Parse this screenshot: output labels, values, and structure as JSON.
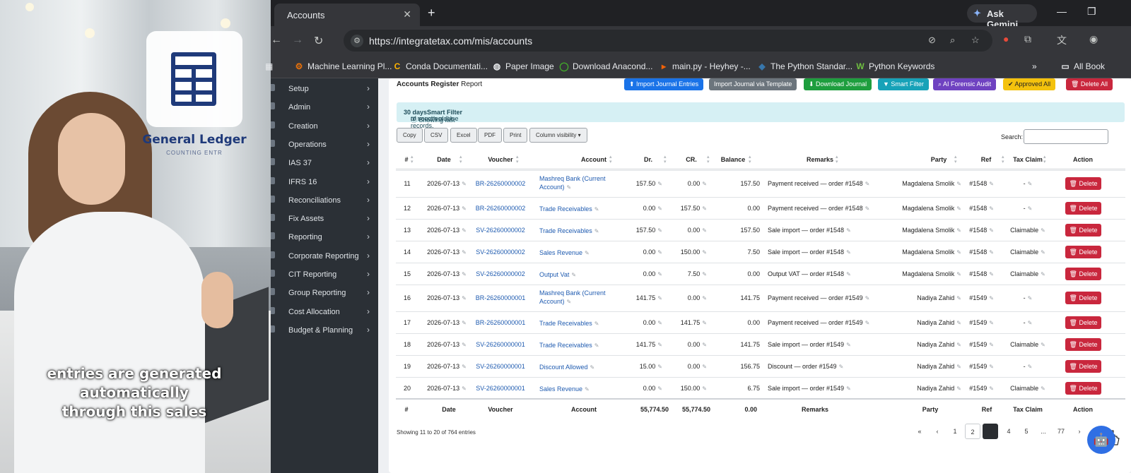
{
  "video": {
    "logo_title": "General Ledger",
    "logo_subtitle": "COUNTING ENTR",
    "caption": [
      "entries are generated",
      "automatically",
      "through this sales"
    ]
  },
  "browser": {
    "tab_title": "Accounts",
    "ask_gemini": "Ask Gemini",
    "url": "https://integratetax.com/mis/accounts",
    "bookmarks": [
      "Machine Learning Pl...",
      "Conda Documentati...",
      "Paper Image",
      "Download Anacond...",
      "main.py - Heyhey -...",
      "The Python Standar...",
      "Python Keywords"
    ],
    "all_bookmarks": "All Book"
  },
  "sidebar": {
    "items": [
      "Setup",
      "Admin",
      "Creation",
      "Operations",
      "IAS 37",
      "IFRS 16",
      "Reconciliations",
      "Fix Assets",
      "Reporting",
      "Corporate Reporting",
      "CIT Reporting",
      "Group Reporting",
      "Cost Allocation",
      "Budget & Planning"
    ]
  },
  "report": {
    "title": "Accounts Register",
    "title_suffix": "Report",
    "actions": [
      {
        "label": "⬆ Import Journal Entries",
        "color": "#1a73e8"
      },
      {
        "label": "Import Journal via Template",
        "color": "#6c757d"
      },
      {
        "label": "⬇ Download Journal",
        "color": "#1e9e3e"
      },
      {
        "label": "▼ Smart Filter",
        "color": "#17a2b8"
      },
      {
        "label": "⌕ AI Forensic Audit",
        "color": "#6f42c1"
      },
      {
        "label": "✔ Approved All",
        "color": "#f4c20d"
      },
      {
        "label": "🗑 Delete All",
        "color": "#c9273d"
      }
    ],
    "info_prefix": "ⓘ Showing last ",
    "info_bold1": "30 days",
    "info_mid": " of vouchers. Use ",
    "info_bold2": "Smart Filter",
    "info_suffix": " to search older records.",
    "dt_buttons": [
      "Copy",
      "CSV",
      "Excel",
      "PDF",
      "Print",
      "Column visibility ▾"
    ],
    "search_label": "Search:",
    "headers": [
      "#",
      "Date",
      "Voucher",
      "Account",
      "Dr.",
      "CR.",
      "Balance",
      "Remarks",
      "Party",
      "Ref",
      "Tax Claim",
      "Action"
    ],
    "rows": [
      {
        "n": "11",
        "date": "2026-07-13",
        "voucher": "BR-26260000002",
        "account": [
          "Mashreq Bank (Current",
          "Account)"
        ],
        "dr": "157.50",
        "cr": "0.00",
        "bal": "157.50",
        "remarks": "Payment received — order #1548",
        "party": "Magdalena Smolik",
        "ref": "#1548",
        "tax": "-"
      },
      {
        "n": "12",
        "date": "2026-07-13",
        "voucher": "BR-26260000002",
        "account": [
          "Trade Receivables"
        ],
        "dr": "0.00",
        "cr": "157.50",
        "bal": "0.00",
        "remarks": "Payment received — order #1548",
        "party": "Magdalena Smolik",
        "ref": "#1548",
        "tax": "-"
      },
      {
        "n": "13",
        "date": "2026-07-13",
        "voucher": "SV-26260000002",
        "account": [
          "Trade Receivables"
        ],
        "dr": "157.50",
        "cr": "0.00",
        "bal": "157.50",
        "remarks": "Sale import — order #1548",
        "party": "Magdalena Smolik",
        "ref": "#1548",
        "tax": "Claimable"
      },
      {
        "n": "14",
        "date": "2026-07-13",
        "voucher": "SV-26260000002",
        "account": [
          "Sales Revenue"
        ],
        "dr": "0.00",
        "cr": "150.00",
        "bal": "7.50",
        "remarks": "Sale import — order #1548",
        "party": "Magdalena Smolik",
        "ref": "#1548",
        "tax": "Claimable"
      },
      {
        "n": "15",
        "date": "2026-07-13",
        "voucher": "SV-26260000002",
        "account": [
          "Output Vat"
        ],
        "dr": "0.00",
        "cr": "7.50",
        "bal": "0.00",
        "remarks": "Output VAT — order #1548",
        "party": "Magdalena Smolik",
        "ref": "#1548",
        "tax": "Claimable"
      },
      {
        "n": "16",
        "date": "2026-07-13",
        "voucher": "BR-26260000001",
        "account": [
          "Mashreq Bank (Current",
          "Account)"
        ],
        "dr": "141.75",
        "cr": "0.00",
        "bal": "141.75",
        "remarks": "Payment received — order #1549",
        "party": "Nadiya Zahid",
        "ref": "#1549",
        "tax": "-"
      },
      {
        "n": "17",
        "date": "2026-07-13",
        "voucher": "BR-26260000001",
        "account": [
          "Trade Receivables"
        ],
        "dr": "0.00",
        "cr": "141.75",
        "bal": "0.00",
        "remarks": "Payment received — order #1549",
        "party": "Nadiya Zahid",
        "ref": "#1549",
        "tax": "-"
      },
      {
        "n": "18",
        "date": "2026-07-13",
        "voucher": "SV-26260000001",
        "account": [
          "Trade Receivables"
        ],
        "dr": "141.75",
        "cr": "0.00",
        "bal": "141.75",
        "remarks": "Sale import — order #1549",
        "party": "Nadiya Zahid",
        "ref": "#1549",
        "tax": "Claimable"
      },
      {
        "n": "19",
        "date": "2026-07-13",
        "voucher": "SV-26260000001",
        "account": [
          "Discount Allowed"
        ],
        "dr": "15.00",
        "cr": "0.00",
        "bal": "156.75",
        "remarks": "Discount — order #1549",
        "party": "Nadiya Zahid",
        "ref": "#1549",
        "tax": "-"
      },
      {
        "n": "20",
        "date": "2026-07-13",
        "voucher": "SV-26260000001",
        "account": [
          "Sales Revenue"
        ],
        "dr": "0.00",
        "cr": "150.00",
        "bal": "6.75",
        "remarks": "Sale import — order #1549",
        "party": "Nadiya Zahid",
        "ref": "#1549",
        "tax": "Claimable"
      }
    ],
    "delete_label": "🗑 Delete",
    "footer": {
      "n": "#",
      "date": "Date",
      "voucher": "Voucher",
      "account": "Account",
      "dr": "55,774.50",
      "cr": "55,774.50",
      "bal": "0.00",
      "remarks": "Remarks",
      "party": "Party",
      "ref": "Ref",
      "tax": "Tax Claim",
      "action": "Action"
    },
    "showing": "Showing 11 to 20 of 764 entries",
    "pagination": [
      "«",
      "‹",
      "1",
      "2",
      "3",
      "4",
      "5",
      "...",
      "77",
      "›"
    ],
    "active_page": "3"
  }
}
